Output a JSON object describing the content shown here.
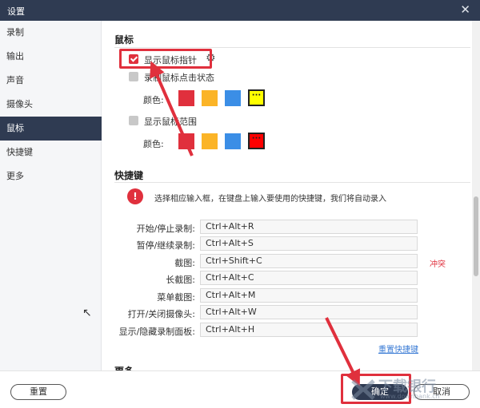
{
  "window": {
    "title": "设置",
    "close_glyph": "✕"
  },
  "sidebar": {
    "items": [
      {
        "label": "录制",
        "active": false
      },
      {
        "label": "输出",
        "active": false
      },
      {
        "label": "声音",
        "active": false
      },
      {
        "label": "摄像头",
        "active": false
      },
      {
        "label": "鼠标",
        "active": true
      },
      {
        "label": "快捷键",
        "active": false
      },
      {
        "label": "更多",
        "active": false
      }
    ]
  },
  "mouse": {
    "title": "鼠标",
    "show_pointer": {
      "label": "显示鼠标指针",
      "checked": true
    },
    "record_clicks": {
      "label": "录制鼠标点击状态",
      "checked": false,
      "color_label": "颜色:"
    },
    "show_area": {
      "label": "显示鼠标范围",
      "checked": false,
      "color_label": "颜色:"
    },
    "click_colors": [
      "#e0303d",
      "#fbb427",
      "#3b8ee6",
      "#ffff00"
    ],
    "area_colors": [
      "#e0303d",
      "#fbb427",
      "#3b8ee6",
      "#ff0000"
    ],
    "custom_glyph": "···"
  },
  "shortcuts": {
    "title": "快捷键",
    "info_glyph": "!",
    "info": "选择相应输入框，在键盘上输入要使用的快捷键，我们将自动录入",
    "rows": [
      {
        "label": "开始/停止录制:",
        "value": "Ctrl+Alt+R"
      },
      {
        "label": "暂停/继续录制:",
        "value": "Ctrl+Alt+S"
      },
      {
        "label": "截图:",
        "value": "Ctrl+Shift+C"
      },
      {
        "label": "长截图:",
        "value": "Ctrl+Alt+C"
      },
      {
        "label": "菜单截图:",
        "value": "Ctrl+Alt+M"
      },
      {
        "label": "打开/关闭摄像头:",
        "value": "Ctrl+Alt+W"
      },
      {
        "label": "显示/隐藏录制面板:",
        "value": "Ctrl+Alt+H"
      }
    ],
    "conflict": "冲突",
    "reset_link": "重置快捷键"
  },
  "more": {
    "title": "更多"
  },
  "footer": {
    "reset": "重置",
    "ok": "确定",
    "cancel": "取消"
  },
  "watermark": {
    "text": "下载银行",
    "sub": "www.downbank.cn"
  },
  "colors": {
    "accent": "#e0303d",
    "titlebar": "#2f3b52",
    "link": "#3a7bd5"
  }
}
